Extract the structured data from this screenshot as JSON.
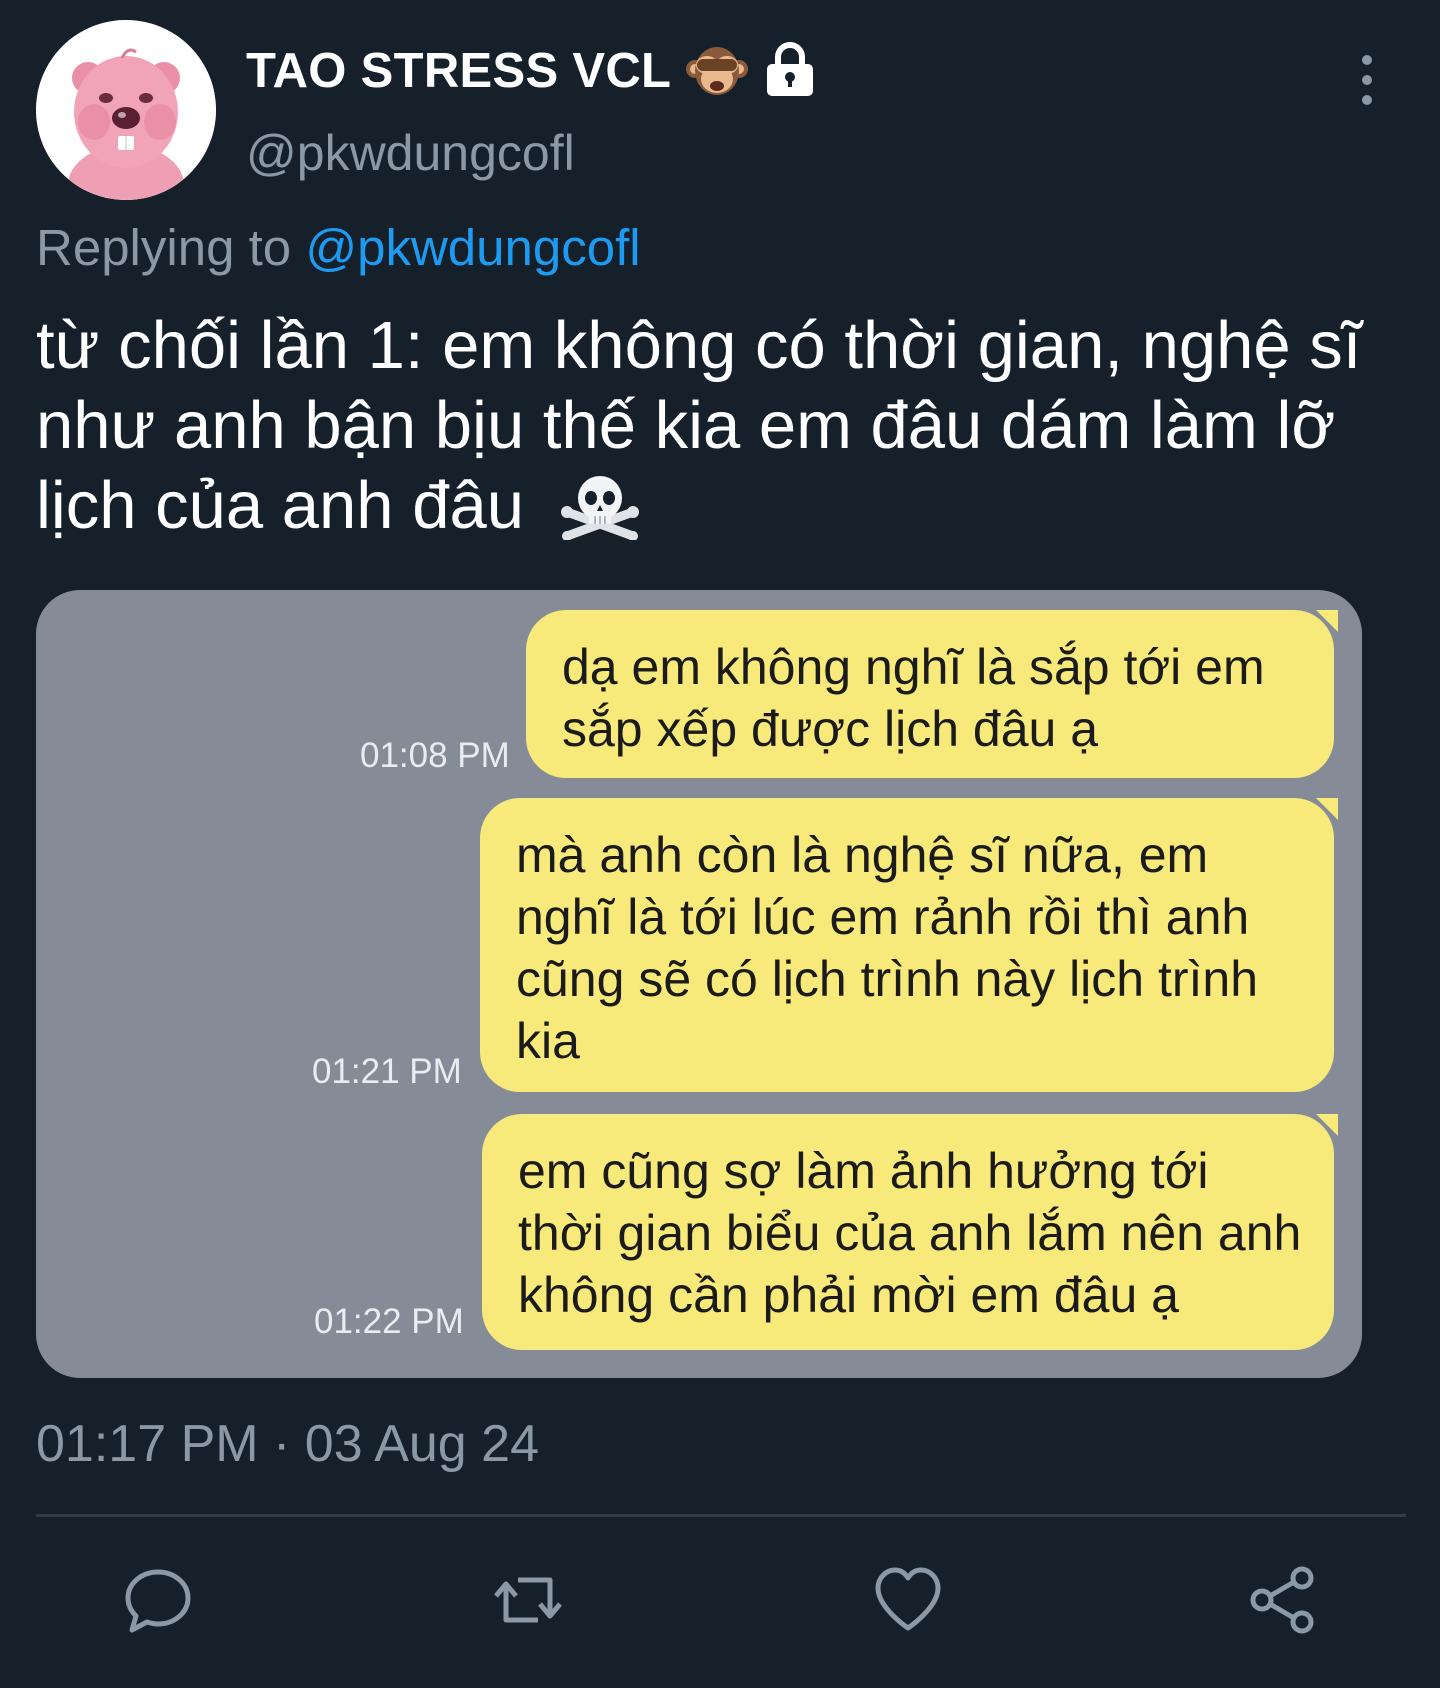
{
  "user": {
    "display_name": "TAO STRESS VCL",
    "handle": "@pkwdungcofl",
    "name_emoji_icon": "see-no-evil-monkey-icon",
    "protected_icon": "lock-icon"
  },
  "reply": {
    "prefix": "Replying to",
    "mention": "@pkwdungcofl"
  },
  "tweet": {
    "text": "từ chối lần 1: em không có thời gian, nghệ sĩ như anh bận bịu thế kia em đâu dám làm lỡ lịch của anh đâu",
    "trailing_emoji_icon": "skull-and-crossbones-icon"
  },
  "media": {
    "messages": [
      {
        "text": "dạ em không nghĩ là sắp tới em sắp xếp được lịch đâu ạ",
        "time": "01:08 PM"
      },
      {
        "text": "mà anh còn là nghệ sĩ nữa, em nghĩ là tới lúc em rảnh rồi thì anh cũng sẽ có lịch trình này lịch trình kia",
        "time": "01:21 PM"
      },
      {
        "text": "em cũng sợ làm ảnh hưởng tới thời gian biểu của anh lắm nên anh không cần phải mời em đâu ạ",
        "time": "01:22 PM"
      }
    ]
  },
  "meta": {
    "timestamp": "01:17 PM · 03 Aug 24"
  },
  "actions": [
    "reply-icon",
    "retweet-icon",
    "like-icon",
    "share-icon"
  ],
  "colors": {
    "background": "#15202b",
    "secondary_text": "#8b98a5",
    "link": "#1d9bf0",
    "bubble": "#f8e97b",
    "media_bg": "#868c97"
  }
}
